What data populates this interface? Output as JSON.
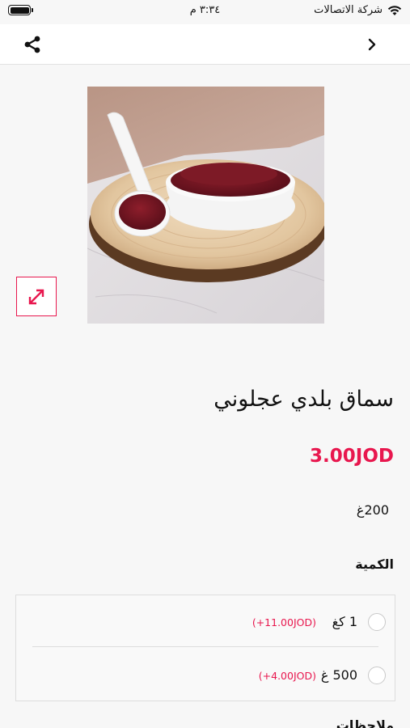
{
  "status_bar": {
    "carrier": "شركة الاتصالات",
    "time": "٣:٣٤ م"
  },
  "top_bar": {
    "share_icon": "share-icon",
    "back_icon": "chevron-right-icon"
  },
  "product": {
    "title": "سماق بلدي عجلوني",
    "price": "3.00JOD",
    "weight": "200غ",
    "image_alt": "sumac powder in a bowl and spoon on a wooden slice"
  },
  "quantity": {
    "label": "الكمية",
    "options": [
      {
        "label": "1 كغ",
        "extra": "(+11.00JOD)",
        "selected": false
      },
      {
        "label": "500 غ",
        "extra": "(+4.00JOD)",
        "selected": false
      }
    ]
  },
  "notes": {
    "label": "ملاحظات"
  },
  "colors": {
    "accent": "#e8174e",
    "background": "#f7f7f7"
  }
}
